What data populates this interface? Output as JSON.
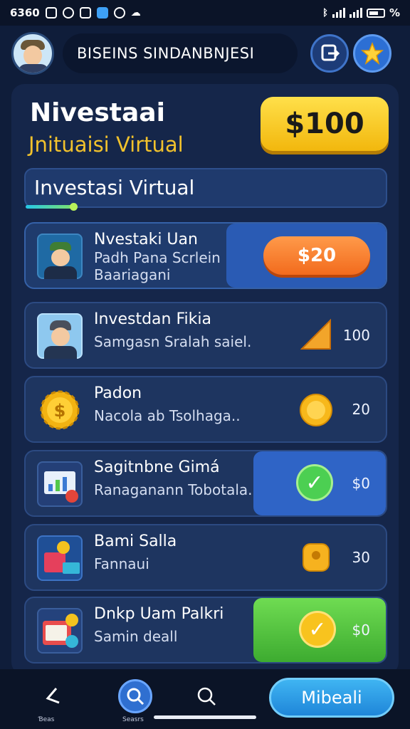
{
  "status_bar": {
    "time": "6360",
    "icons": [
      "notification-icon",
      "vpn-icon",
      "message-icon",
      "app-icon",
      "camera-icon",
      "cloud-icon"
    ],
    "right_text": "⁠ᵢₗₗ",
    "battery_percent": "%"
  },
  "header": {
    "title": "BISEINS SINDANBNJESI",
    "buttons": [
      "exit-icon",
      "star-icon"
    ]
  },
  "hero": {
    "title": "Nivestaai",
    "subtitle": "Jnituaisi Virtual",
    "balance": "$100"
  },
  "section": {
    "title": "Investasi Virtual",
    "progress": 0.13
  },
  "items": [
    {
      "title": "Nvestaki Uan",
      "subtitle": "Padh Pana Scrlein",
      "subtitle2": "Baariagani",
      "action": "$20",
      "icon": "soldier-avatar-icon"
    },
    {
      "title": "Investdan Fikia",
      "subtitle": "Samgasn Sralah saiel.",
      "value": "100",
      "icon": "worker-avatar-icon",
      "status_icon": "trend-icon"
    },
    {
      "title": "Padon",
      "subtitle": "Nacola ab Tsolhaga..",
      "value": "20",
      "icon": "coin-gear-icon",
      "status_icon": "coin-icon"
    },
    {
      "title": "Sagitnbne Gimá",
      "subtitle": "Ranaganann Tobotala.",
      "value": "$0",
      "icon": "chart-board-icon",
      "status_icon": "check-icon"
    },
    {
      "title": "Bami Salla",
      "subtitle": "Fannaui",
      "value": "30",
      "icon": "gift-box-icon",
      "status_icon": "location-icon"
    },
    {
      "title": "Dnkp Uam Palkri",
      "subtitle": "Samin deall",
      "value": "$0",
      "icon": "invoice-icon",
      "status_icon": "check-icon"
    }
  ],
  "nav": {
    "back_label": "Ɓeas",
    "search_label": "Seasrs",
    "buy_label": "Mibeali"
  },
  "colors": {
    "accent_yellow": "#f2c22c",
    "accent_orange": "#f26b1d",
    "accent_green": "#53c84a",
    "accent_blue": "#2c6fd4"
  }
}
